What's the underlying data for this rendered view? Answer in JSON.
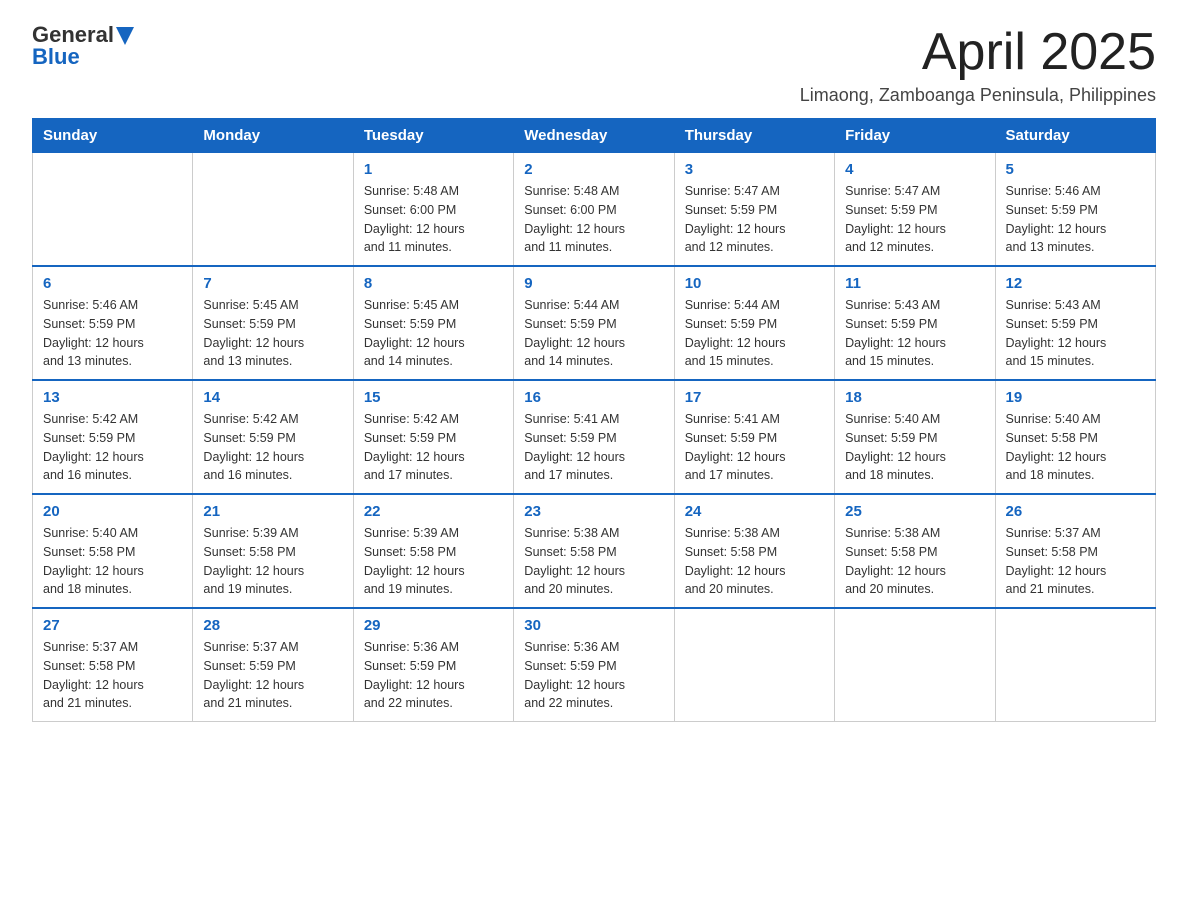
{
  "header": {
    "logo_general": "General",
    "logo_blue": "Blue",
    "title": "April 2025",
    "location": "Limaong, Zamboanga Peninsula, Philippines"
  },
  "weekdays": [
    "Sunday",
    "Monday",
    "Tuesday",
    "Wednesday",
    "Thursday",
    "Friday",
    "Saturday"
  ],
  "weeks": [
    [
      {
        "day": "",
        "info": ""
      },
      {
        "day": "",
        "info": ""
      },
      {
        "day": "1",
        "info": "Sunrise: 5:48 AM\nSunset: 6:00 PM\nDaylight: 12 hours\nand 11 minutes."
      },
      {
        "day": "2",
        "info": "Sunrise: 5:48 AM\nSunset: 6:00 PM\nDaylight: 12 hours\nand 11 minutes."
      },
      {
        "day": "3",
        "info": "Sunrise: 5:47 AM\nSunset: 5:59 PM\nDaylight: 12 hours\nand 12 minutes."
      },
      {
        "day": "4",
        "info": "Sunrise: 5:47 AM\nSunset: 5:59 PM\nDaylight: 12 hours\nand 12 minutes."
      },
      {
        "day": "5",
        "info": "Sunrise: 5:46 AM\nSunset: 5:59 PM\nDaylight: 12 hours\nand 13 minutes."
      }
    ],
    [
      {
        "day": "6",
        "info": "Sunrise: 5:46 AM\nSunset: 5:59 PM\nDaylight: 12 hours\nand 13 minutes."
      },
      {
        "day": "7",
        "info": "Sunrise: 5:45 AM\nSunset: 5:59 PM\nDaylight: 12 hours\nand 13 minutes."
      },
      {
        "day": "8",
        "info": "Sunrise: 5:45 AM\nSunset: 5:59 PM\nDaylight: 12 hours\nand 14 minutes."
      },
      {
        "day": "9",
        "info": "Sunrise: 5:44 AM\nSunset: 5:59 PM\nDaylight: 12 hours\nand 14 minutes."
      },
      {
        "day": "10",
        "info": "Sunrise: 5:44 AM\nSunset: 5:59 PM\nDaylight: 12 hours\nand 15 minutes."
      },
      {
        "day": "11",
        "info": "Sunrise: 5:43 AM\nSunset: 5:59 PM\nDaylight: 12 hours\nand 15 minutes."
      },
      {
        "day": "12",
        "info": "Sunrise: 5:43 AM\nSunset: 5:59 PM\nDaylight: 12 hours\nand 15 minutes."
      }
    ],
    [
      {
        "day": "13",
        "info": "Sunrise: 5:42 AM\nSunset: 5:59 PM\nDaylight: 12 hours\nand 16 minutes."
      },
      {
        "day": "14",
        "info": "Sunrise: 5:42 AM\nSunset: 5:59 PM\nDaylight: 12 hours\nand 16 minutes."
      },
      {
        "day": "15",
        "info": "Sunrise: 5:42 AM\nSunset: 5:59 PM\nDaylight: 12 hours\nand 17 minutes."
      },
      {
        "day": "16",
        "info": "Sunrise: 5:41 AM\nSunset: 5:59 PM\nDaylight: 12 hours\nand 17 minutes."
      },
      {
        "day": "17",
        "info": "Sunrise: 5:41 AM\nSunset: 5:59 PM\nDaylight: 12 hours\nand 17 minutes."
      },
      {
        "day": "18",
        "info": "Sunrise: 5:40 AM\nSunset: 5:59 PM\nDaylight: 12 hours\nand 18 minutes."
      },
      {
        "day": "19",
        "info": "Sunrise: 5:40 AM\nSunset: 5:58 PM\nDaylight: 12 hours\nand 18 minutes."
      }
    ],
    [
      {
        "day": "20",
        "info": "Sunrise: 5:40 AM\nSunset: 5:58 PM\nDaylight: 12 hours\nand 18 minutes."
      },
      {
        "day": "21",
        "info": "Sunrise: 5:39 AM\nSunset: 5:58 PM\nDaylight: 12 hours\nand 19 minutes."
      },
      {
        "day": "22",
        "info": "Sunrise: 5:39 AM\nSunset: 5:58 PM\nDaylight: 12 hours\nand 19 minutes."
      },
      {
        "day": "23",
        "info": "Sunrise: 5:38 AM\nSunset: 5:58 PM\nDaylight: 12 hours\nand 20 minutes."
      },
      {
        "day": "24",
        "info": "Sunrise: 5:38 AM\nSunset: 5:58 PM\nDaylight: 12 hours\nand 20 minutes."
      },
      {
        "day": "25",
        "info": "Sunrise: 5:38 AM\nSunset: 5:58 PM\nDaylight: 12 hours\nand 20 minutes."
      },
      {
        "day": "26",
        "info": "Sunrise: 5:37 AM\nSunset: 5:58 PM\nDaylight: 12 hours\nand 21 minutes."
      }
    ],
    [
      {
        "day": "27",
        "info": "Sunrise: 5:37 AM\nSunset: 5:58 PM\nDaylight: 12 hours\nand 21 minutes."
      },
      {
        "day": "28",
        "info": "Sunrise: 5:37 AM\nSunset: 5:59 PM\nDaylight: 12 hours\nand 21 minutes."
      },
      {
        "day": "29",
        "info": "Sunrise: 5:36 AM\nSunset: 5:59 PM\nDaylight: 12 hours\nand 22 minutes."
      },
      {
        "day": "30",
        "info": "Sunrise: 5:36 AM\nSunset: 5:59 PM\nDaylight: 12 hours\nand 22 minutes."
      },
      {
        "day": "",
        "info": ""
      },
      {
        "day": "",
        "info": ""
      },
      {
        "day": "",
        "info": ""
      }
    ]
  ]
}
